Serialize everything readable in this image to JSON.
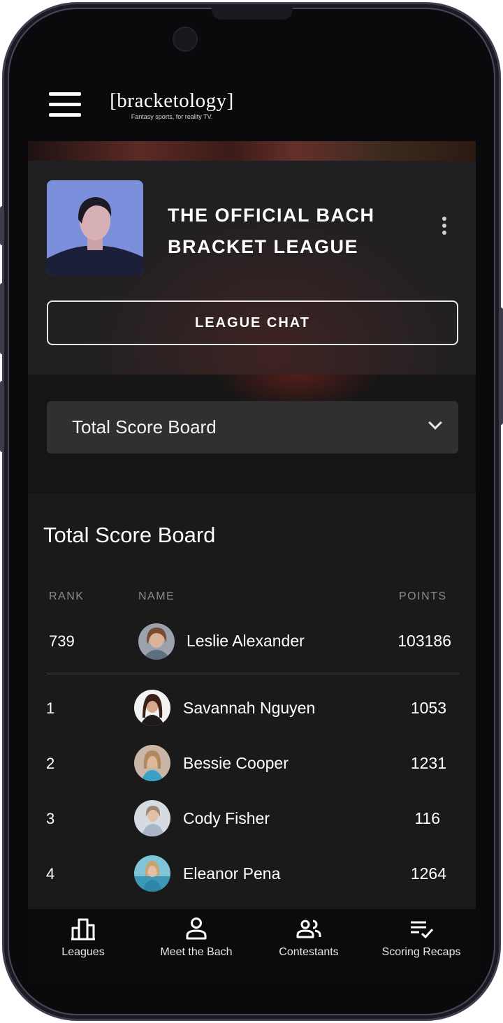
{
  "header": {
    "logo_text": "[bracketology]",
    "tagline": "Fantasy sports, for reality TV."
  },
  "league": {
    "title": "THE OFFICIAL BACH BRACKET LEAGUE",
    "chat_button": "LEAGUE CHAT"
  },
  "selector": {
    "selected": "Total Score Board"
  },
  "board": {
    "title": "Total Score Board",
    "columns": {
      "rank": "RANK",
      "name": "NAME",
      "points": "POINTS"
    },
    "current_user": {
      "rank": "739",
      "name": "Leslie Alexander",
      "points": "103186"
    },
    "rows": [
      {
        "rank": "1",
        "name": "Savannah Nguyen",
        "points": "1053"
      },
      {
        "rank": "2",
        "name": "Bessie Cooper",
        "points": "1231"
      },
      {
        "rank": "3",
        "name": "Cody Fisher",
        "points": "116"
      },
      {
        "rank": "4",
        "name": "Eleanor Pena",
        "points": "1264"
      }
    ]
  },
  "nav": {
    "items": [
      {
        "label": "Leagues",
        "icon": "leaderboard-icon"
      },
      {
        "label": "Meet the Bach",
        "icon": "person-icon"
      },
      {
        "label": "Contestants",
        "icon": "group-icon"
      },
      {
        "label": "Scoring Recaps",
        "icon": "checklist-icon"
      }
    ]
  },
  "colors": {
    "background": "#0a0a0d",
    "panel": "#202022",
    "dropdown": "#303033",
    "text": "#ffffff",
    "muted": "#8a8a8e"
  }
}
